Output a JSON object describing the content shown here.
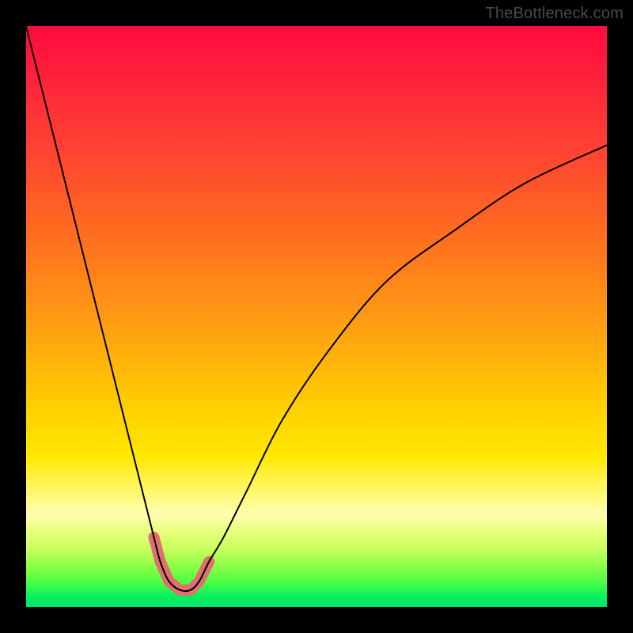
{
  "credit": "TheBottleneck.com",
  "colors": {
    "frame": "#000000",
    "curve": "#000000",
    "highlight": "#e07070"
  },
  "chart_data": {
    "type": "line",
    "title": "",
    "xlabel": "",
    "ylabel": "",
    "xlim": [
      0,
      100
    ],
    "ylim": [
      0,
      100
    ],
    "grid": false,
    "legend": false,
    "annotations": [
      "TheBottleneck.com"
    ],
    "series": [
      {
        "name": "bottleneck-curve",
        "x": [
          0,
          2,
          4,
          6,
          8,
          10,
          12,
          14,
          16,
          18,
          20,
          22,
          23.1,
          24.6,
          26.5,
          28.3,
          29.8,
          31.5,
          34,
          38,
          44,
          52,
          62,
          74,
          86,
          100
        ],
        "y": [
          100,
          92,
          84,
          76,
          68,
          60,
          52,
          44,
          36,
          28,
          20,
          12,
          7.8,
          4.4,
          2.9,
          2.9,
          4.4,
          7.8,
          12,
          20,
          32,
          44,
          56,
          65,
          73,
          79.5
        ]
      }
    ],
    "highlight_segments": [
      {
        "x": [
          22.0,
          23.1
        ],
        "y": [
          12.0,
          7.8
        ]
      },
      {
        "x": [
          23.1,
          24.6
        ],
        "y": [
          7.8,
          4.4
        ]
      },
      {
        "x": [
          24.6,
          26.5
        ],
        "y": [
          4.4,
          2.9
        ]
      },
      {
        "x": [
          26.5,
          28.3
        ],
        "y": [
          2.9,
          2.9
        ]
      },
      {
        "x": [
          28.3,
          29.8
        ],
        "y": [
          2.9,
          4.4
        ]
      },
      {
        "x": [
          29.8,
          31.5
        ],
        "y": [
          4.4,
          7.8
        ]
      }
    ]
  }
}
